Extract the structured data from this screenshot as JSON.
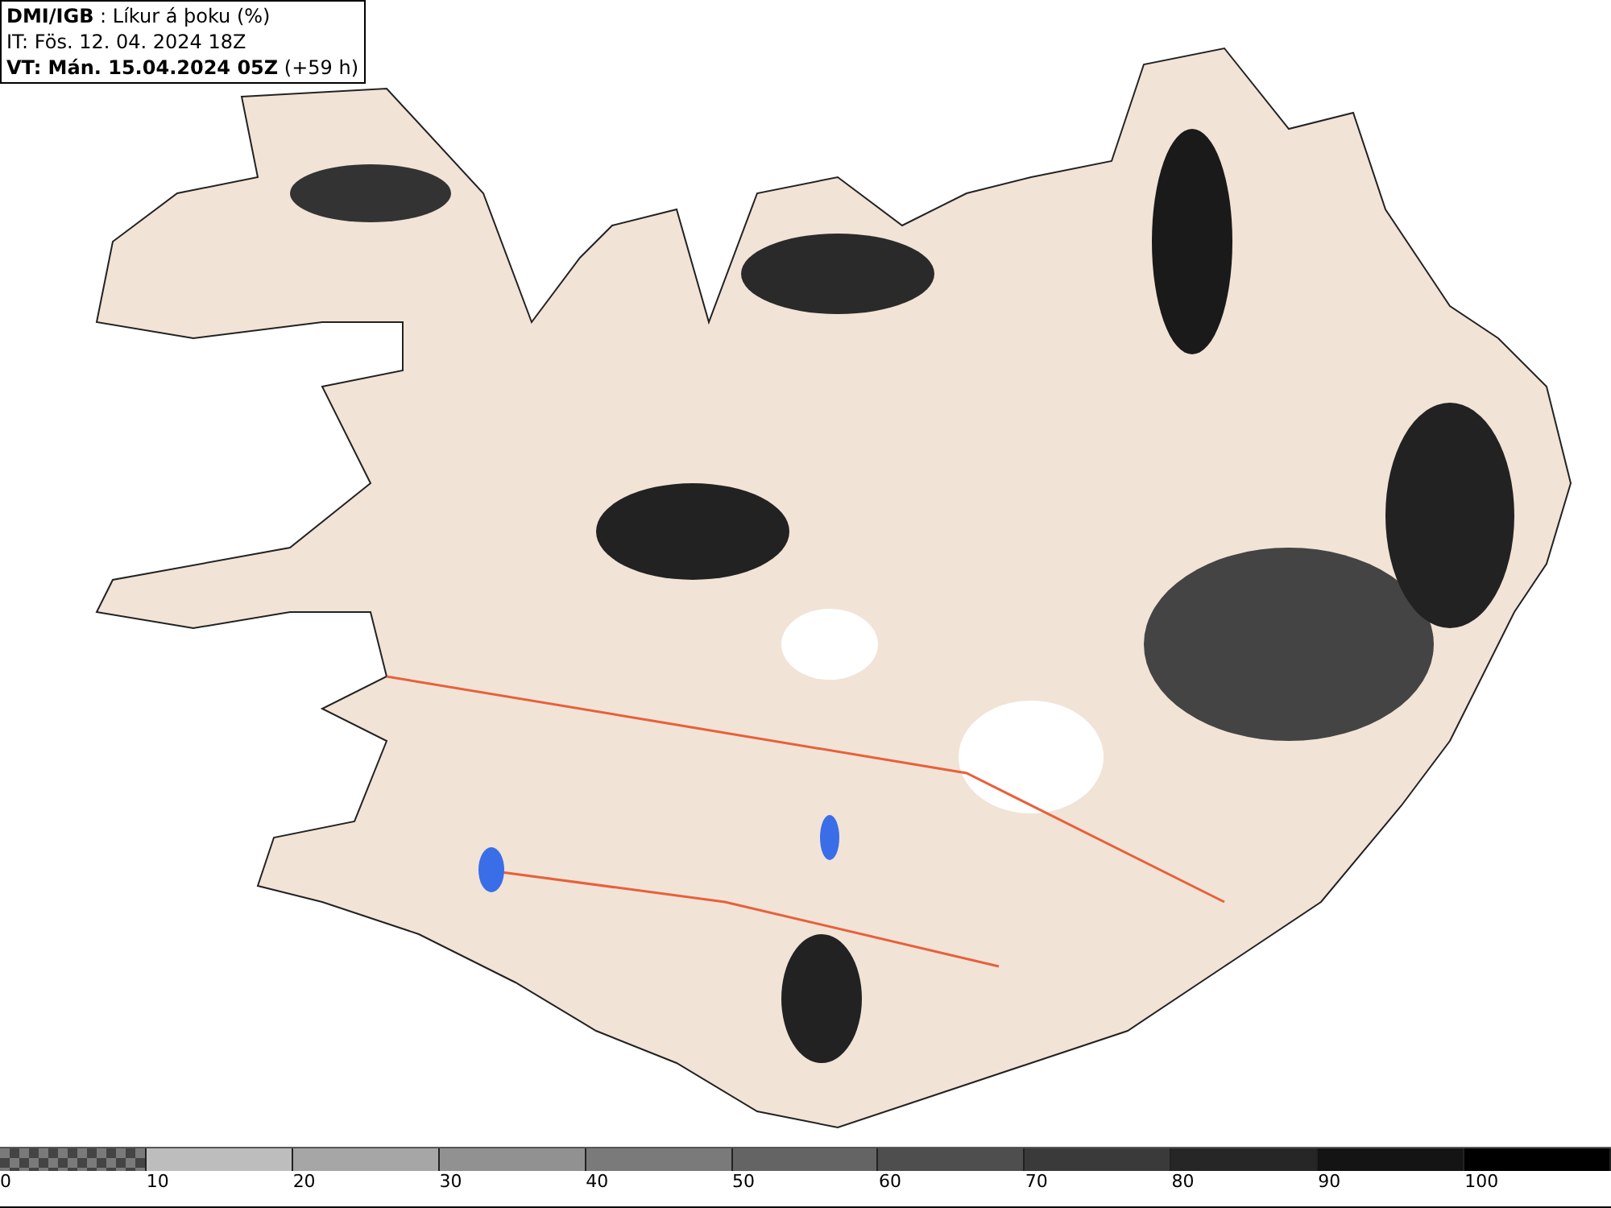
{
  "header": {
    "lines": [
      "**DMI/IGB** : Líkur á þoku (%)",
      "IT: Fös. 12. 04. 2024 18Z",
      "**VT: Mán. 15.04.2024 05Z** (+59 h)"
    ]
  },
  "legend": [
    {
      "label": "0",
      "kind": "pattern",
      "color": "#7a7a7a"
    },
    {
      "label": "10",
      "kind": "solid",
      "color": "#bdbdbd"
    },
    {
      "label": "20",
      "kind": "solid",
      "color": "#a6a6a6"
    },
    {
      "label": "30",
      "kind": "solid",
      "color": "#919191"
    },
    {
      "label": "40",
      "kind": "solid",
      "color": "#7a7a7a"
    },
    {
      "label": "50",
      "kind": "solid",
      "color": "#646464"
    },
    {
      "label": "60",
      "kind": "solid",
      "color": "#4e4e4e"
    },
    {
      "label": "70",
      "kind": "solid",
      "color": "#3a3a3a"
    },
    {
      "label": "80",
      "kind": "solid",
      "color": "#262626"
    },
    {
      "label": "90",
      "kind": "solid",
      "color": "#141414"
    },
    {
      "label": "100",
      "kind": "solid",
      "color": "#000000"
    }
  ]
}
